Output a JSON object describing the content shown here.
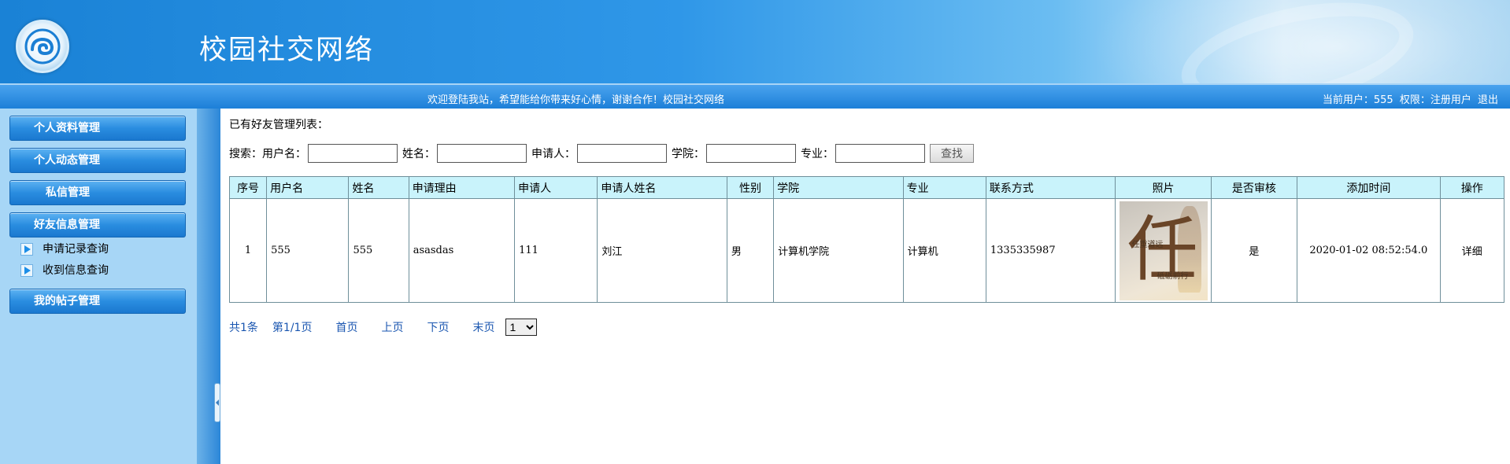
{
  "header": {
    "site_title": "校园社交网络"
  },
  "statusbar": {
    "welcome": "欢迎登陆我站，希望能给你带来好心情，谢谢合作！校园社交网络",
    "current_user_label": "当前用户：555",
    "role_label": "权限：注册用户",
    "logout": "退出"
  },
  "sidebar": {
    "menus": [
      {
        "label": "个人资料管理"
      },
      {
        "label": "个人动态管理"
      },
      {
        "label": "私信管理"
      },
      {
        "label": "好友信息管理"
      },
      {
        "label": "我的帖子管理"
      }
    ],
    "sub_items": [
      {
        "label": "申请记录查询"
      },
      {
        "label": "收到信息查询"
      }
    ]
  },
  "main": {
    "list_title": "已有好友管理列表：",
    "search": {
      "prefix": "搜索：",
      "username_label": "用户名：",
      "name_label": "姓名：",
      "applicant_label": "申请人：",
      "college_label": "学院：",
      "major_label": "专业：",
      "button": "查找",
      "username_value": "",
      "name_value": "",
      "applicant_value": "",
      "college_value": "",
      "major_value": ""
    },
    "table": {
      "headers": [
        "序号",
        "用户名",
        "姓名",
        "申请理由",
        "申请人",
        "申请人姓名",
        "性别",
        "学院",
        "专业",
        "联系方式",
        "照片",
        "是否审核",
        "添加时间",
        "操作"
      ],
      "rows": [
        {
          "index": "1",
          "username": "555",
          "name": "555",
          "reason": "asasdas",
          "applicant": "111",
          "applicant_name": "刘江",
          "gender": "男",
          "college": "计算机学院",
          "major": "计算机",
          "contact": "1335335987",
          "photo_text_big": "任",
          "photo_text_1": "任重道远",
          "photo_text_2": "砥砺前行",
          "reviewed": "是",
          "added_time": "2020-01-02 08:52:54.0",
          "action": "详细"
        }
      ]
    },
    "pager": {
      "total": "共1条",
      "page": "第1/1页",
      "first": "首页",
      "prev": "上页",
      "next": "下页",
      "last": "末页",
      "selected_page": "1"
    }
  }
}
